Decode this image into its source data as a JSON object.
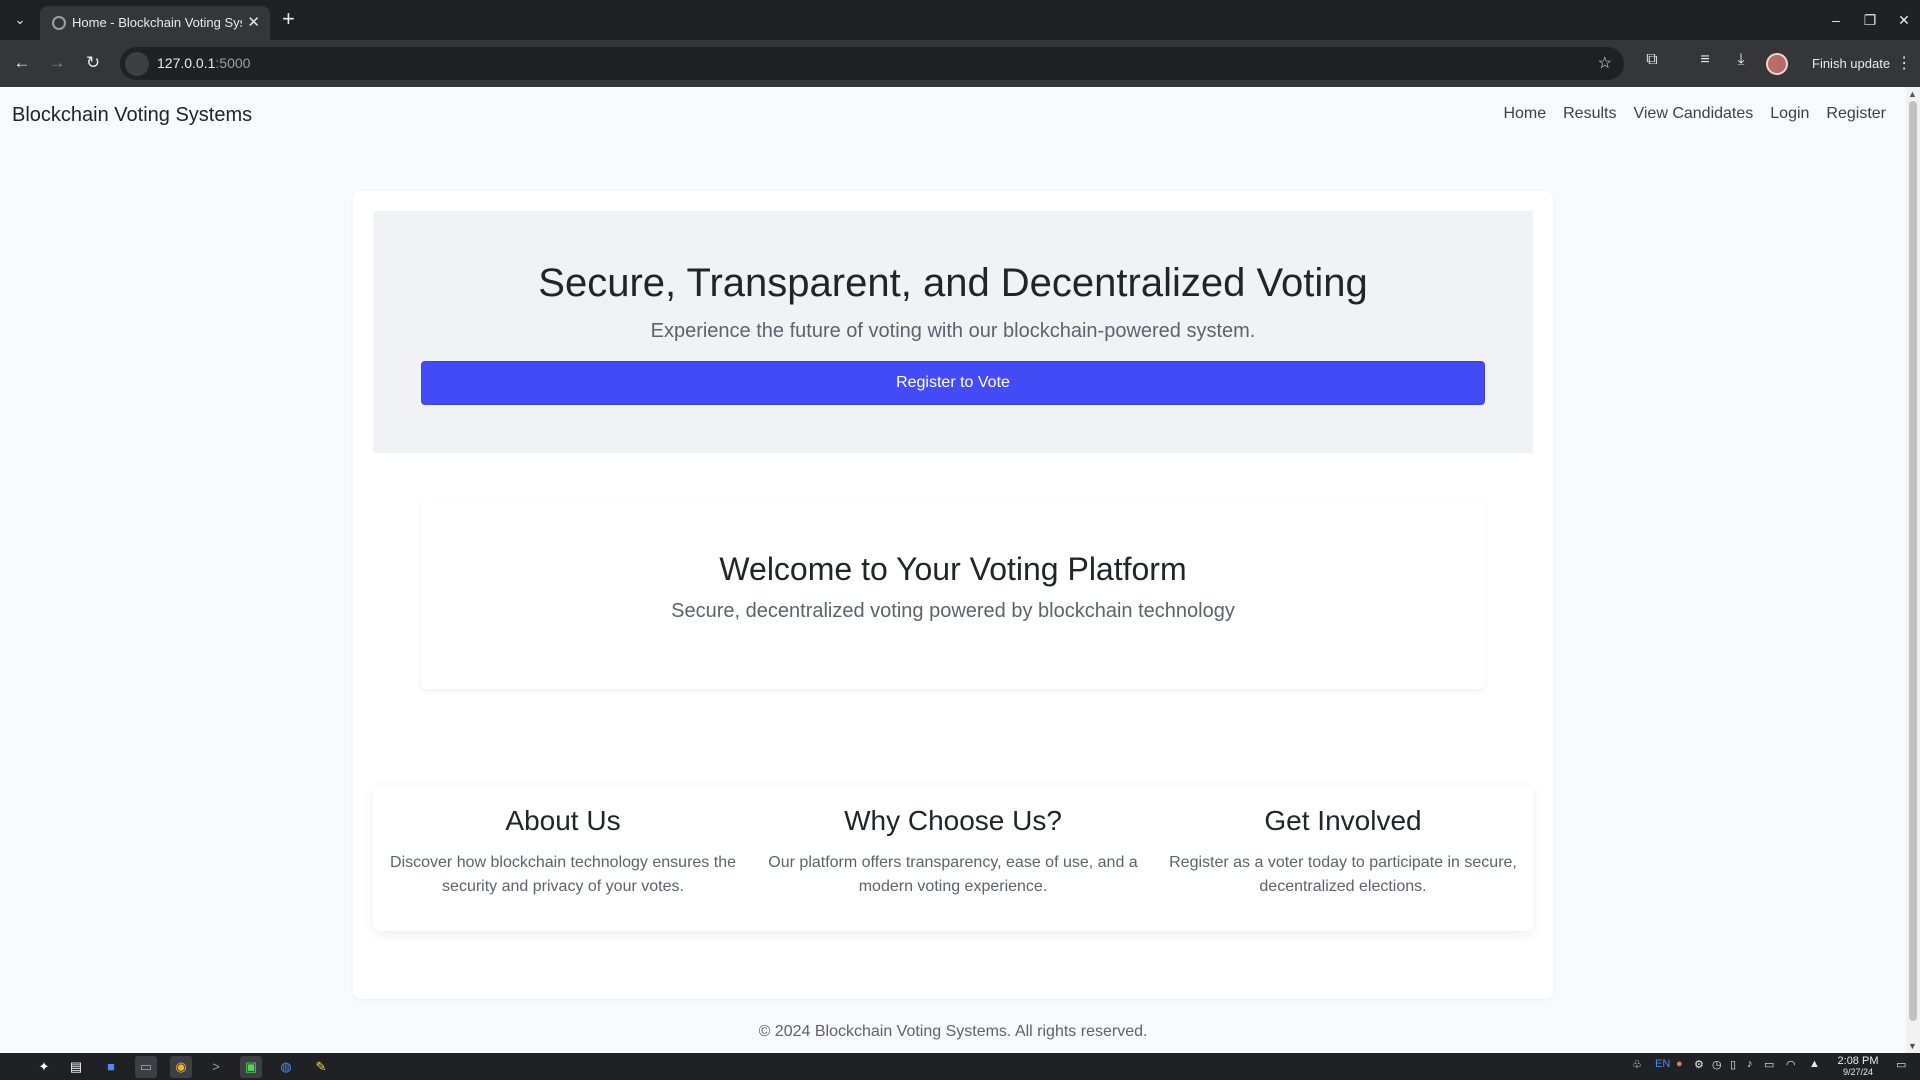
{
  "browser": {
    "tab_title": "Home - Blockchain Voting Systems",
    "url_host": "127.0.0.1",
    "url_port": ":5000",
    "finish_update_label": "Finish update"
  },
  "site": {
    "brand": "Blockchain Voting Systems",
    "nav": [
      "Home",
      "Results",
      "View Candidates",
      "Login",
      "Register"
    ]
  },
  "hero": {
    "title": "Secure, Transparent, and Decentralized Voting",
    "subtitle": "Experience the future of voting with our blockchain-powered system.",
    "cta_label": "Register to Vote",
    "cta_color": "#444cf7"
  },
  "welcome": {
    "title": "Welcome to Your Voting Platform",
    "subtitle": "Secure, decentralized voting powered by blockchain technology"
  },
  "features": [
    {
      "title": "About Us",
      "text": "Discover how blockchain technology ensures the security and privacy of your votes."
    },
    {
      "title": "Why Choose Us?",
      "text": "Our platform offers transparency, ease of use, and a modern voting experience."
    },
    {
      "title": "Get Involved",
      "text": "Register as a voter today to participate in secure, decentralized elections."
    }
  ],
  "footer": "© 2024 Blockchain Voting Systems. All rights reserved.",
  "taskbar": {
    "tray_lang": "EN",
    "time": "2:08 PM",
    "date": "9/27/24"
  }
}
